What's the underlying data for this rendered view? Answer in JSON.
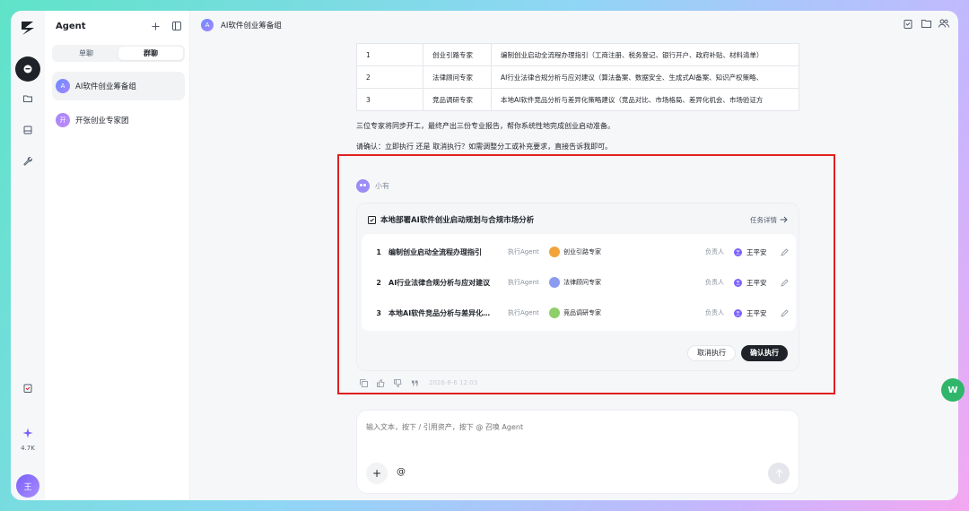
{
  "rail": {
    "credit": "4.7K",
    "user_initial": "王",
    "icons": [
      "chat-icon",
      "folder-icon",
      "storage-icon",
      "wrench-icon",
      "checklist-icon",
      "sparkle-icon"
    ]
  },
  "sidebar": {
    "title": "Agent",
    "tabs": [
      "单聊",
      "群聊"
    ],
    "active_tab": "群聊",
    "groups": [
      {
        "initial": "A",
        "name": "AI软件创业筹备组",
        "active": true
      },
      {
        "initial": "开",
        "name": "开张创业专家团",
        "active": false
      }
    ]
  },
  "header": {
    "initial": "A",
    "title": "AI软件创业筹备组"
  },
  "table": {
    "rows": [
      [
        "1",
        "创业引路专家",
        "编制创业启动全流程办理指引（工商注册、税务登记、银行开户、政府补贴、材料清单）"
      ],
      [
        "2",
        "法律顾问专家",
        "AI行业法律合规分析与应对建议（算法备案、数据安全、生成式AI备案、知识产权策略、"
      ],
      [
        "3",
        "竞品调研专家",
        "本地AI软件竞品分析与差异化策略建议（竞品对比、市场格局、差异化机会、市场验证方"
      ]
    ]
  },
  "messages": {
    "p1": "三位专家将同步开工，最终产出三份专业报告，帮你系统性地完成创业启动准备。",
    "p2": "请确认：立即执行 还是 取消执行？如需调整分工或补充要求，直接告诉我即可。"
  },
  "bot": {
    "name": "小有"
  },
  "task_card": {
    "title": "本地部署AI软件创业启动规划与合规市场分析",
    "detail_link": "任务详情",
    "exec_label": "执行Agent",
    "owner_label": "负责人",
    "tasks": [
      {
        "num": "1",
        "title": "编制创业启动全流程办理指引",
        "agent": "创业引路专家",
        "agent_color": "#f2a33a",
        "owner": "王平安"
      },
      {
        "num": "2",
        "title": "AI行业法律合规分析与应对建议",
        "agent": "法律顾问专家",
        "agent_color": "#8b9cf0",
        "owner": "王平安"
      },
      {
        "num": "3",
        "title": "本地AI软件竞品分析与差异化…",
        "agent": "竞品调研专家",
        "agent_color": "#8fcf6a",
        "owner": "王平安"
      }
    ],
    "cancel": "取消执行",
    "confirm": "确认执行"
  },
  "meta": {
    "timestamp": "2026-8-6 12:03"
  },
  "composer": {
    "placeholder": "输入文本，按下 / 引用资产，按下 @ 召唤 Agent",
    "at": "@",
    "plus": "+"
  },
  "float_badge": "W"
}
